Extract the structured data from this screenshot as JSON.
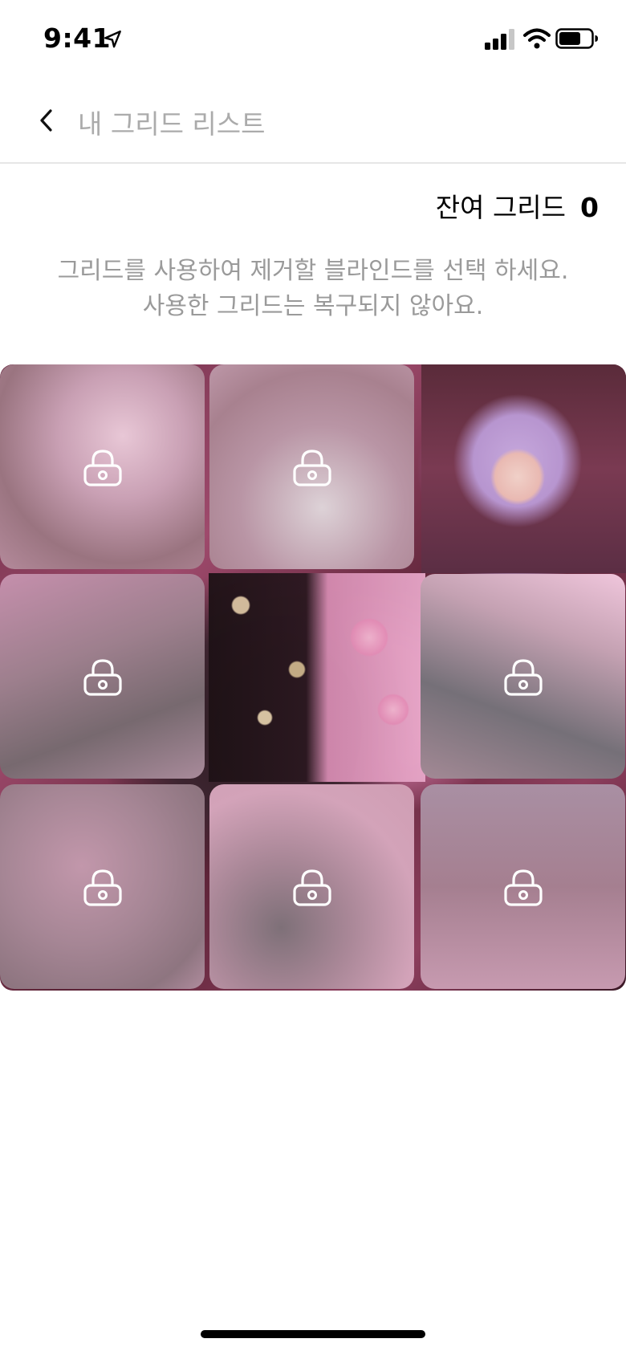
{
  "status_bar": {
    "time": "9:41",
    "icons": [
      "location-arrow-icon",
      "cellular-signal-icon",
      "wifi-icon",
      "battery-icon"
    ]
  },
  "nav": {
    "title": "내 그리드 리스트",
    "back_icon": "chevron-left-icon"
  },
  "remaining": {
    "label": "잔여 그리드",
    "count": "0"
  },
  "instruction": {
    "line1": "그리드를 사용하여 제거할 블라인드를 선택 하세요.",
    "line2": "사용한 그리드는 복구되지 않아요."
  },
  "grid": {
    "tiles": [
      {
        "position": 1,
        "state": "locked",
        "icon": "lock-icon"
      },
      {
        "position": 2,
        "state": "locked",
        "icon": "lock-icon"
      },
      {
        "position": 3,
        "state": "revealed"
      },
      {
        "position": 4,
        "state": "locked",
        "icon": "lock-icon"
      },
      {
        "position": 5,
        "state": "revealed"
      },
      {
        "position": 6,
        "state": "locked",
        "icon": "lock-icon"
      },
      {
        "position": 7,
        "state": "locked",
        "icon": "lock-icon"
      },
      {
        "position": 8,
        "state": "locked",
        "icon": "lock-icon"
      },
      {
        "position": 9,
        "state": "locked",
        "icon": "lock-icon"
      }
    ]
  },
  "colors": {
    "title_gray": "#ababab",
    "instruction_gray": "#9a9a9a",
    "divider": "#e6e6e6"
  }
}
